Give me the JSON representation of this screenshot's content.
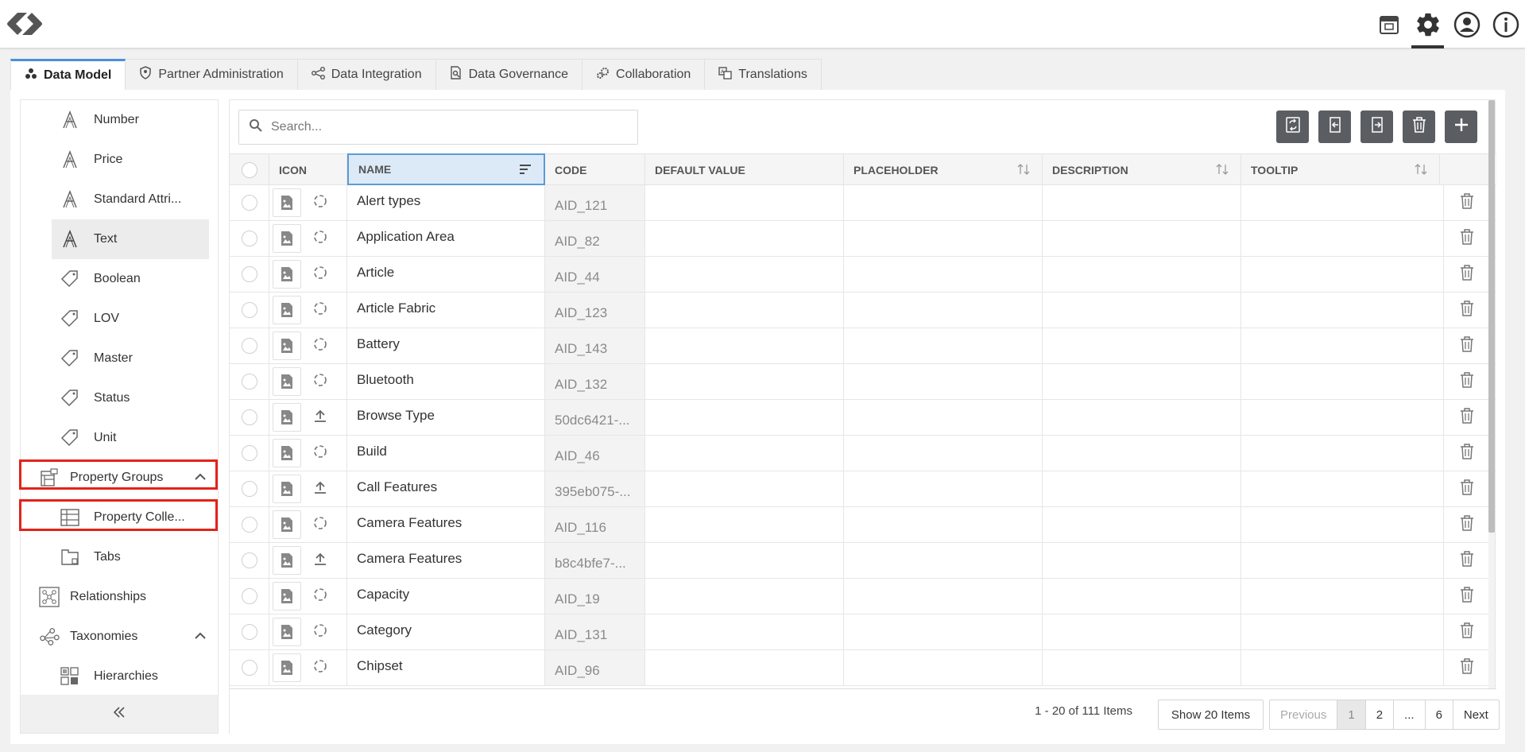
{
  "header": {
    "icons": [
      "logo-icon",
      "inbox-icon",
      "gear-icon",
      "user-icon",
      "info-icon"
    ]
  },
  "tabs": [
    {
      "label": "Data Model",
      "icon": "data-model-icon",
      "active": true
    },
    {
      "label": "Partner Administration",
      "icon": "shield-icon"
    },
    {
      "label": "Data Integration",
      "icon": "share-icon"
    },
    {
      "label": "Data Governance",
      "icon": "doc-search-icon"
    },
    {
      "label": "Collaboration",
      "icon": "gears-icon"
    },
    {
      "label": "Translations",
      "icon": "translate-icon"
    }
  ],
  "sidebar": {
    "items": [
      {
        "label": "Number",
        "icon": "attribute-icon"
      },
      {
        "label": "Price",
        "icon": "attribute-icon"
      },
      {
        "label": "Standard Attri...",
        "icon": "attribute-icon"
      },
      {
        "label": "Text",
        "icon": "attribute-icon",
        "selected": true
      },
      {
        "label": "Boolean",
        "icon": "tag-icon"
      },
      {
        "label": "LOV",
        "icon": "tag-icon"
      },
      {
        "label": "Master",
        "icon": "tag-icon"
      },
      {
        "label": "Status",
        "icon": "tag-icon"
      },
      {
        "label": "Unit",
        "icon": "tag-icon"
      },
      {
        "label": "Property Groups",
        "icon": "property-groups-icon",
        "expanded": true
      },
      {
        "label": "Property Colle...",
        "icon": "table-icon"
      },
      {
        "label": "Tabs",
        "icon": "tabs-icon"
      },
      {
        "label": "Relationships",
        "icon": "relationships-icon"
      },
      {
        "label": "Taxonomies",
        "icon": "taxonomies-icon",
        "expanded": true
      },
      {
        "label": "Hierarchies",
        "icon": "hierarchies-icon"
      }
    ]
  },
  "search": {
    "placeholder": "Search..."
  },
  "table": {
    "columns": [
      "ICON",
      "NAME",
      "CODE",
      "DEFAULT VALUE",
      "PLACEHOLDER",
      "DESCRIPTION",
      "TOOLTIP"
    ],
    "rows": [
      {
        "name": "Alert types",
        "code": "AID_121",
        "status": "sync"
      },
      {
        "name": "Application Area",
        "code": "AID_82",
        "status": "sync"
      },
      {
        "name": "Article",
        "code": "AID_44",
        "status": "sync"
      },
      {
        "name": "Article Fabric",
        "code": "AID_123",
        "status": "sync"
      },
      {
        "name": "Battery",
        "code": "AID_143",
        "status": "sync"
      },
      {
        "name": "Bluetooth",
        "code": "AID_132",
        "status": "sync"
      },
      {
        "name": "Browse Type",
        "code": "50dc6421-...",
        "status": "upload"
      },
      {
        "name": "Build",
        "code": "AID_46",
        "status": "sync"
      },
      {
        "name": "Call Features",
        "code": "395eb075-...",
        "status": "upload"
      },
      {
        "name": "Camera Features",
        "code": "AID_116",
        "status": "sync"
      },
      {
        "name": "Camera Features",
        "code": "b8c4bfe7-...",
        "status": "upload"
      },
      {
        "name": "Capacity",
        "code": "AID_19",
        "status": "sync"
      },
      {
        "name": "Category",
        "code": "AID_131",
        "status": "sync"
      },
      {
        "name": "Chipset",
        "code": "AID_96",
        "status": "sync"
      }
    ]
  },
  "footer": {
    "count": "1 - 20 of 111 Items",
    "show_label": "Show 20 Items",
    "pages": [
      "Previous",
      "1",
      "2",
      "...",
      "6",
      "Next"
    ]
  }
}
